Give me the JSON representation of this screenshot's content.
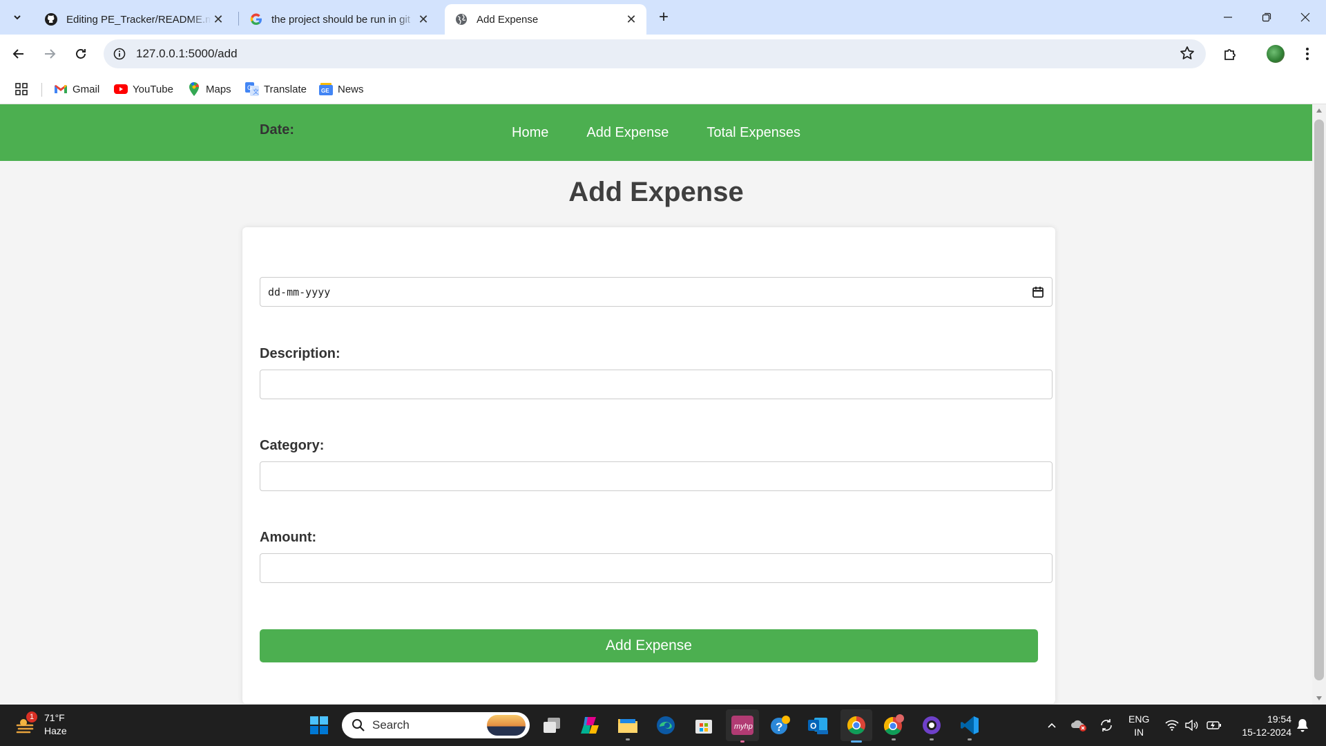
{
  "browser": {
    "tabs": [
      {
        "title": "Editing PE_Tracker/README.md",
        "icon": "github-icon"
      },
      {
        "title": "the project should be run in git",
        "icon": "google-icon"
      },
      {
        "title": "Add Expense",
        "icon": "globe-icon"
      }
    ],
    "new_tab_label": "+",
    "url": "127.0.0.1:5000/add",
    "bookmarks": [
      {
        "label": "Gmail",
        "icon": "gmail-icon"
      },
      {
        "label": "YouTube",
        "icon": "youtube-icon"
      },
      {
        "label": "Maps",
        "icon": "maps-icon"
      },
      {
        "label": "Translate",
        "icon": "translate-icon"
      },
      {
        "label": "News",
        "icon": "news-icon"
      }
    ]
  },
  "site": {
    "nav": [
      "Home",
      "Add Expense",
      "Total Expenses"
    ],
    "heading": "Add Expense",
    "form": {
      "date_label": "Date:",
      "date_placeholder": "dd-mm-yyyy",
      "description_label": "Description:",
      "description_value": "",
      "category_label": "Category:",
      "category_value": "",
      "amount_label": "Amount:",
      "amount_value": "",
      "submit_label": "Add Expense"
    },
    "colors": {
      "primary": "#4caf50",
      "background": "#f4f4f4",
      "card": "#ffffff"
    }
  },
  "taskbar": {
    "weather": {
      "temp": "71°F",
      "condition": "Haze",
      "badge": "1"
    },
    "search_placeholder": "Search",
    "language": {
      "line1": "ENG",
      "line2": "IN"
    },
    "clock": {
      "time": "19:54",
      "date": "15-12-2024"
    }
  }
}
